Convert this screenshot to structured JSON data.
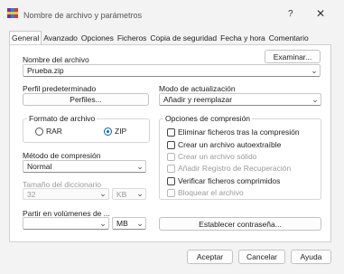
{
  "window": {
    "title": "Nombre de archivo y parámetros",
    "help_glyph": "?",
    "close_glyph": "✕"
  },
  "tabs": [
    "General",
    "Avanzado",
    "Opciones",
    "Ficheros",
    "Copia de seguridad",
    "Fecha y hora",
    "Comentario"
  ],
  "archive_name": {
    "label": "Nombre del archivo",
    "value": "Prueba.zip",
    "browse_button": "Examinar..."
  },
  "profile": {
    "label": "Perfil predeterminado",
    "button": "Perfiles..."
  },
  "update_mode": {
    "label": "Modo de actualización",
    "value": "Añadir y reemplazar"
  },
  "archive_format": {
    "title": "Formato de archivo",
    "options": [
      "RAR",
      "ZIP"
    ],
    "selected": "ZIP"
  },
  "compression_options": {
    "title": "Opciones de compresión",
    "items": [
      {
        "label": "Eliminar ficheros tras la compresión",
        "checked": false,
        "enabled": true
      },
      {
        "label": "Crear un archivo autoextraíble",
        "checked": false,
        "enabled": true
      },
      {
        "label": "Crear un archivo sólido",
        "checked": false,
        "enabled": false
      },
      {
        "label": "Añadir Registro de Recuperación",
        "checked": false,
        "enabled": false
      },
      {
        "label": "Verificar ficheros comprimidos",
        "checked": false,
        "enabled": true
      },
      {
        "label": "Bloquear el archivo",
        "checked": false,
        "enabled": false
      }
    ]
  },
  "compression_method": {
    "label": "Método de compresión",
    "value": "Normal"
  },
  "dictionary_size": {
    "label": "Tamaño del diccionario",
    "value": "32",
    "unit": "KB"
  },
  "split_volumes": {
    "label": "Partir en volúmenes de ...",
    "value": "",
    "unit": "MB"
  },
  "set_password_button": "Establecer contraseña...",
  "footer": {
    "ok": "Aceptar",
    "cancel": "Cancelar",
    "help": "Ayuda"
  },
  "colors": {
    "accent": "#0067c0",
    "window_bg": "#f3f3f3",
    "panel_bg": "#ffffff"
  }
}
